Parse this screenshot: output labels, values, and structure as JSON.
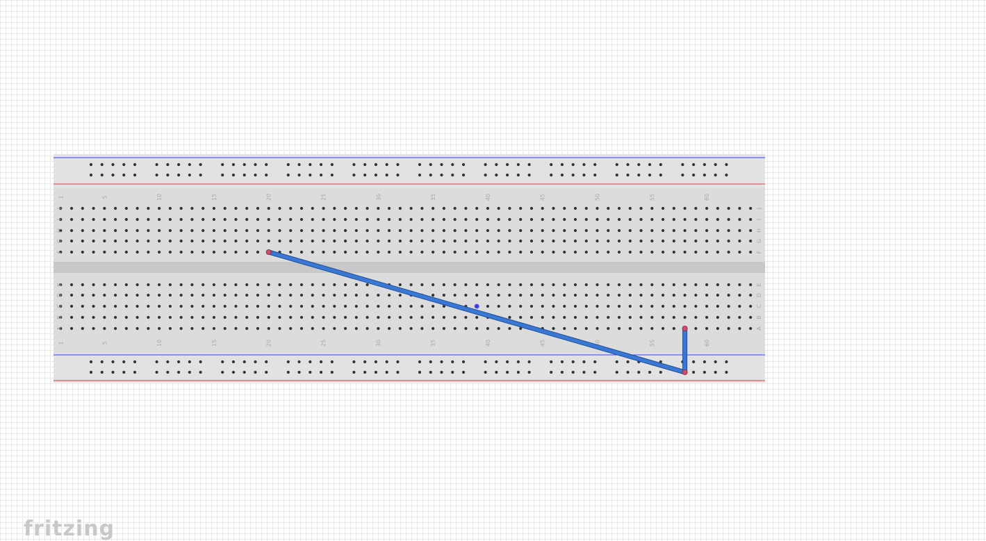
{
  "app": {
    "watermark": "fritzing"
  },
  "breadboard": {
    "column_labels": [
      "1",
      "5",
      "10",
      "15",
      "20",
      "25",
      "30",
      "35",
      "40",
      "45",
      "50",
      "55",
      "60"
    ],
    "row_labels_top": [
      "J",
      "I",
      "H",
      "G",
      "F"
    ],
    "row_labels_bottom": [
      "E",
      "D",
      "C",
      "B",
      "A"
    ],
    "colors": {
      "body": "#dcdcdc",
      "channel": "#c8c8c8",
      "hole": "#333333",
      "rail_blue": "#3a3aff",
      "rail_red": "#e03a3a",
      "label": "#a8a8a8"
    }
  },
  "wires": [
    {
      "name": "wire-long",
      "from": "F20",
      "to": "bottom-rail-1-col-58",
      "color": "#3a78d4"
    },
    {
      "name": "wire-short",
      "from": "A58",
      "to": "bottom-rail-1-col-58",
      "color": "#3a78d4"
    }
  ],
  "highlighted_hole": {
    "ref": "C39",
    "color": "#3a3aff"
  },
  "colors": {
    "wire": "#3a78d4",
    "wire_edge": "#1d4f9a",
    "wire_end": "#c8506c",
    "grid": "#eaeaea"
  }
}
